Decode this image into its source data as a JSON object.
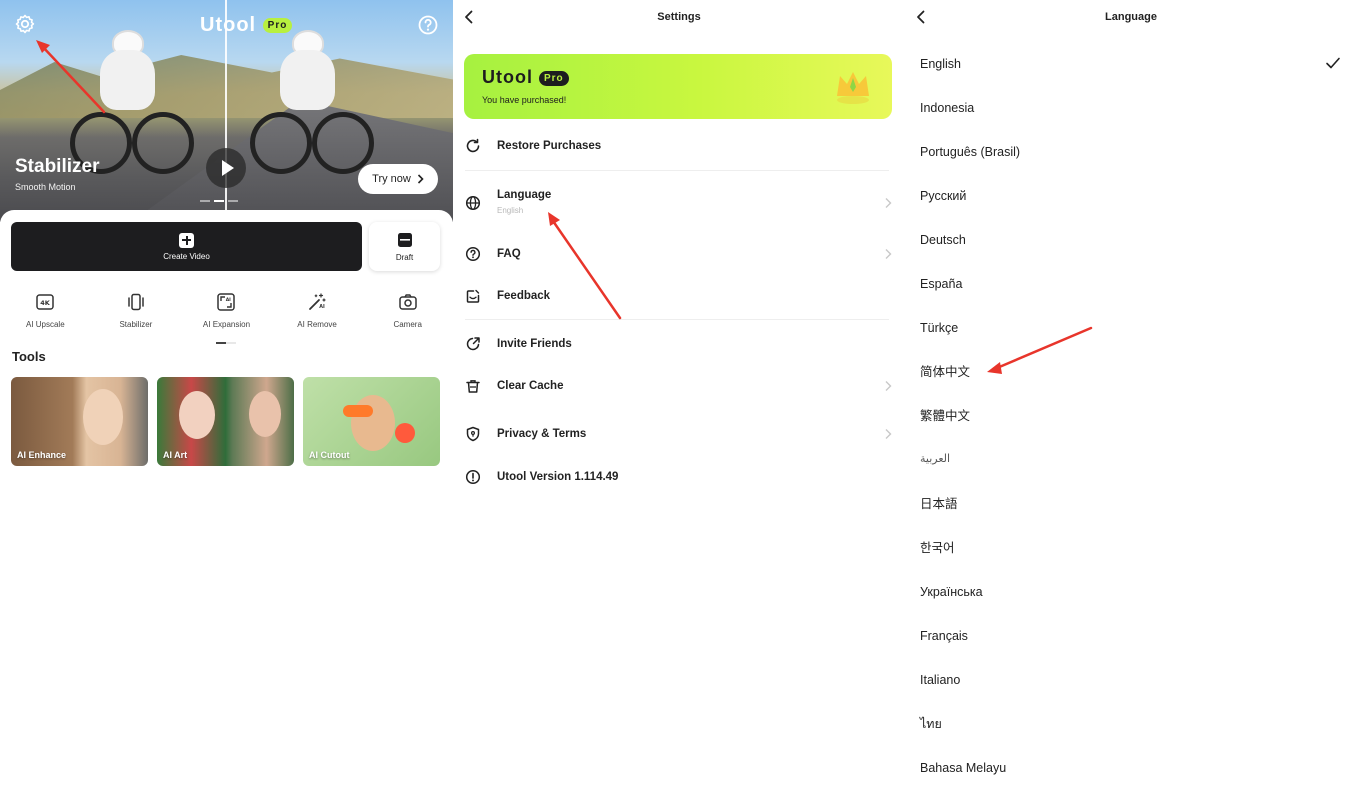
{
  "home": {
    "brand": "Utool",
    "pro_badge": "Pro",
    "hero": {
      "title": "Stabilizer",
      "subtitle": "Smooth Motion",
      "try_now": "Try now"
    },
    "create_video_label": "Create Video",
    "draft_label": "Draft",
    "quick_actions": [
      {
        "label": "AI Upscale",
        "icon": "4k-icon"
      },
      {
        "label": "Stabilizer",
        "icon": "vibrate-icon"
      },
      {
        "label": "AI Expansion",
        "icon": "expand-icon"
      },
      {
        "label": "AI Remove",
        "icon": "magic-wand-icon"
      },
      {
        "label": "Camera",
        "icon": "camera-icon"
      }
    ],
    "tools_title": "Tools",
    "tools": [
      {
        "label": "AI Enhance"
      },
      {
        "label": "AI Art"
      },
      {
        "label": "AI Cutout"
      }
    ]
  },
  "settings": {
    "title": "Settings",
    "banner": {
      "brand": "Utool",
      "pro_badge": "Pro",
      "subtitle": "You have purchased!"
    },
    "items": [
      {
        "label": "Restore Purchases",
        "icon": "restore-icon"
      },
      {
        "label": "Language",
        "value": "English",
        "icon": "globe-icon"
      },
      {
        "label": "FAQ",
        "icon": "question-icon"
      },
      {
        "label": "Feedback",
        "icon": "feedback-icon"
      },
      {
        "label": "Invite Friends",
        "icon": "share-icon"
      },
      {
        "label": "Clear Cache",
        "icon": "trash-icon"
      },
      {
        "label": "Privacy & Terms",
        "icon": "shield-icon"
      },
      {
        "label": "Utool Version 1.114.49",
        "icon": "info-icon"
      }
    ]
  },
  "language": {
    "title": "Language",
    "selected": "English",
    "options": [
      "English",
      "Indonesia",
      "Português (Brasil)",
      "Русский",
      "Deutsch",
      "España",
      "Türkçe",
      "简体中文",
      "繁體中文",
      "العربية",
      "日本語",
      "한국어",
      "Українська",
      "Français",
      "Italiano",
      "ไทย",
      "Bahasa Melayu"
    ]
  },
  "colors": {
    "accent_green": "#b8f03f",
    "annotation_red": "#e8352b",
    "dark_button": "#1d1d1f"
  }
}
